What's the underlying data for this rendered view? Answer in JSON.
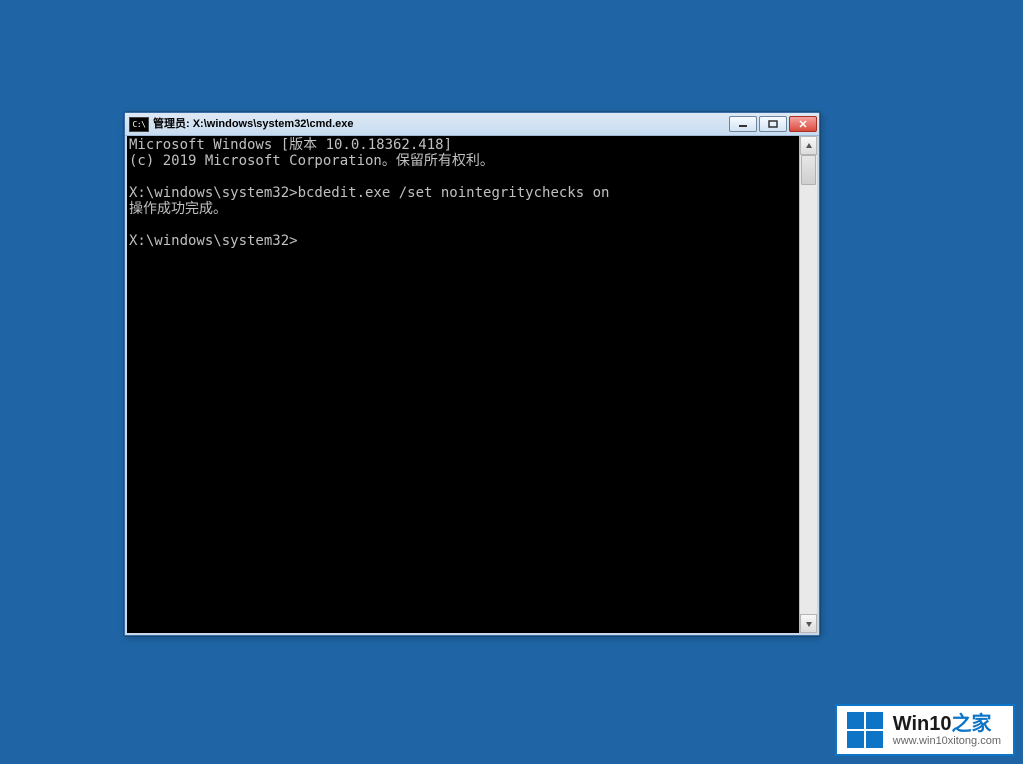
{
  "window": {
    "title": "管理员: X:\\windows\\system32\\cmd.exe",
    "icon_label": "C:\\"
  },
  "console": {
    "line1": "Microsoft Windows [版本 10.0.18362.418]",
    "line2": "(c) 2019 Microsoft Corporation。保留所有权利。",
    "blank": "",
    "prompt1_path": "X:\\windows\\system32>",
    "prompt1_cmd": "bcdedit.exe /set nointegritychecks on",
    "result": "操作成功完成。",
    "prompt2_path": "X:\\windows\\system32>"
  },
  "watermark": {
    "title_prefix": "Win10",
    "title_suffix": "之家",
    "url": "www.win10xitong.com"
  }
}
